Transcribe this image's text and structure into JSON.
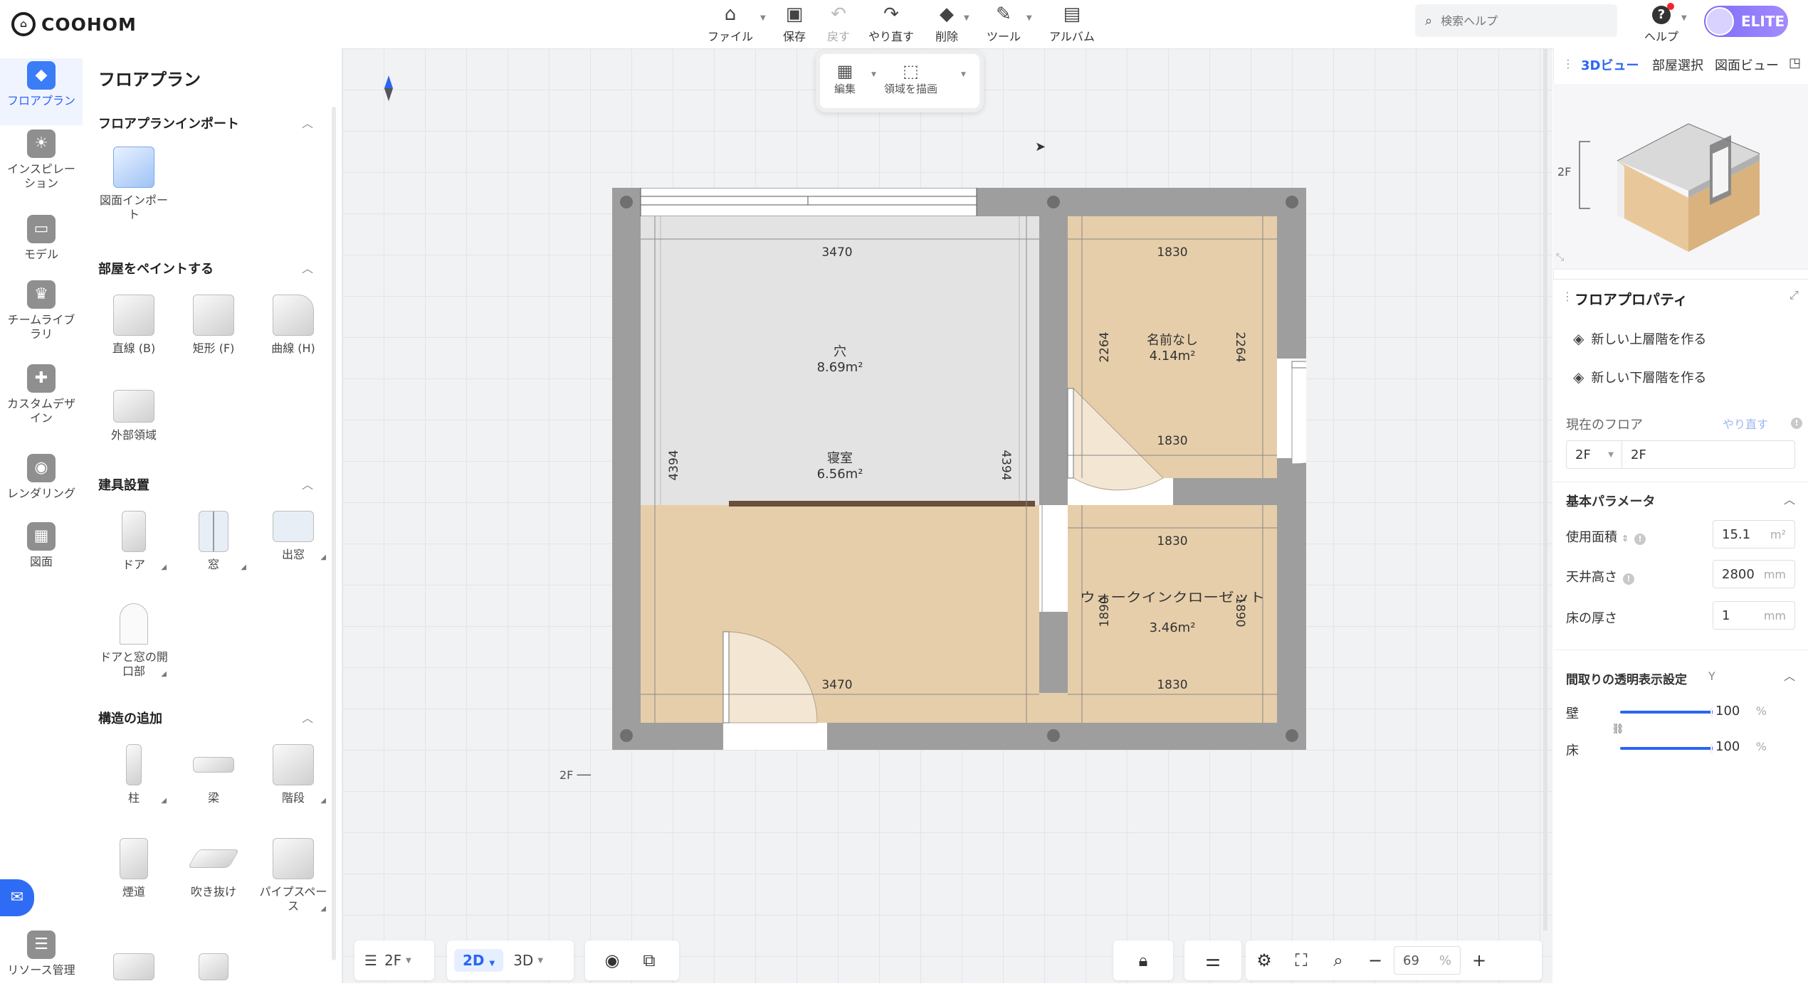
{
  "app": {
    "logo_text": "COOHOM"
  },
  "toolbar": {
    "file": "ファイル",
    "save": "保存",
    "undo": "戻す",
    "redo": "やり直す",
    "delete": "削除",
    "tools": "ツール",
    "album": "アルバム"
  },
  "search": {
    "placeholder": "検索ヘルプ"
  },
  "help": {
    "label": "ヘルプ"
  },
  "account": {
    "badge": "ELITE"
  },
  "rail": {
    "items": [
      {
        "label": "フロアプラン",
        "icon": "floorplan-icon"
      },
      {
        "label": "インスピレーション",
        "icon": "inspiration-icon"
      },
      {
        "label": "モデル",
        "icon": "model-icon"
      },
      {
        "label": "チームライブラリ",
        "icon": "team-library-icon"
      },
      {
        "label": "カスタムデザイン",
        "icon": "custom-design-icon"
      },
      {
        "label": "レンダリング",
        "icon": "rendering-icon"
      },
      {
        "label": "図面",
        "icon": "drawing-icon"
      },
      {
        "label": "リソース管理",
        "icon": "resource-icon"
      }
    ]
  },
  "panel": {
    "title": "フロアプラン",
    "sections": {
      "import": {
        "title": "フロアプランインポート",
        "items": [
          "図面インポート"
        ]
      },
      "paint": {
        "title": "部屋をペイントする",
        "items": [
          "直線 (B)",
          "矩形 (F)",
          "曲線 (H)",
          "外部領域"
        ]
      },
      "fixtures": {
        "title": "建具設置",
        "items": [
          "ドア",
          "窓",
          "出窓",
          "ドアと窓の開口部"
        ]
      },
      "structure": {
        "title": "構造の追加",
        "items": [
          "柱",
          "梁",
          "階段",
          "煙道",
          "吹き抜け",
          "パイプスペース"
        ]
      }
    }
  },
  "canvas": {
    "edit_popup": {
      "edit": "編集",
      "draw_region": "領域を描画"
    },
    "floor_tag": "2F",
    "rooms": [
      {
        "name": "穴",
        "area": "8.69m²"
      },
      {
        "name": "寝室",
        "area": "6.56m²"
      },
      {
        "name": "名前なし",
        "area": "4.14m²"
      },
      {
        "name": "ウォークインクローゼット",
        "area": "3.46m²"
      }
    ],
    "dims": {
      "top_left": "3470",
      "bottom_left": "3470",
      "left_v": "4394",
      "left_v2": "4394",
      "top_right": "1830",
      "mid_right": "1830",
      "mid_right2": "1830",
      "bottom_right": "1830",
      "right_v1": "2264",
      "right_v1b": "2264",
      "right_v2": "1890",
      "right_v2b": "1890"
    }
  },
  "bottom": {
    "floor": "2F",
    "view2d": "2D",
    "view3d": "3D",
    "zoom_value": "69",
    "zoom_unit": "%"
  },
  "rpanel": {
    "tabs": [
      "3Dビュー",
      "部屋選択",
      "図面ビュー"
    ],
    "mini_floor": "2F",
    "props_title": "フロアプロパティ",
    "new_upper": "新しい上層階を作る",
    "new_lower": "新しい下層階を作る",
    "current_floor_label": "現在のフロア",
    "current_floor_redo": "やり直す",
    "floor_select": "2F",
    "floor_name": "2F",
    "basic_params": "基本パラメータ",
    "usable_area_label": "使用面積",
    "usable_area_value": "15.1",
    "usable_area_unit": "m²",
    "ceiling_label": "天井高さ",
    "ceiling_value": "2800",
    "ceiling_unit": "mm",
    "floor_thick_label": "床の厚さ",
    "floor_thick_value": "1",
    "floor_thick_unit": "mm",
    "transparency_title": "間取りの透明表示設定",
    "transparency_hint": "Y",
    "wall_label": "壁",
    "wall_value": "100",
    "wall_level": 1.0,
    "floor_label": "床",
    "floor_value": "100",
    "floor_level": 1.0,
    "pct": "%"
  },
  "colors": {
    "accent": "#2b65f5",
    "wood": "#e6ceaa",
    "wall": "#9e9e9e",
    "hole": "#e3e3e3"
  }
}
